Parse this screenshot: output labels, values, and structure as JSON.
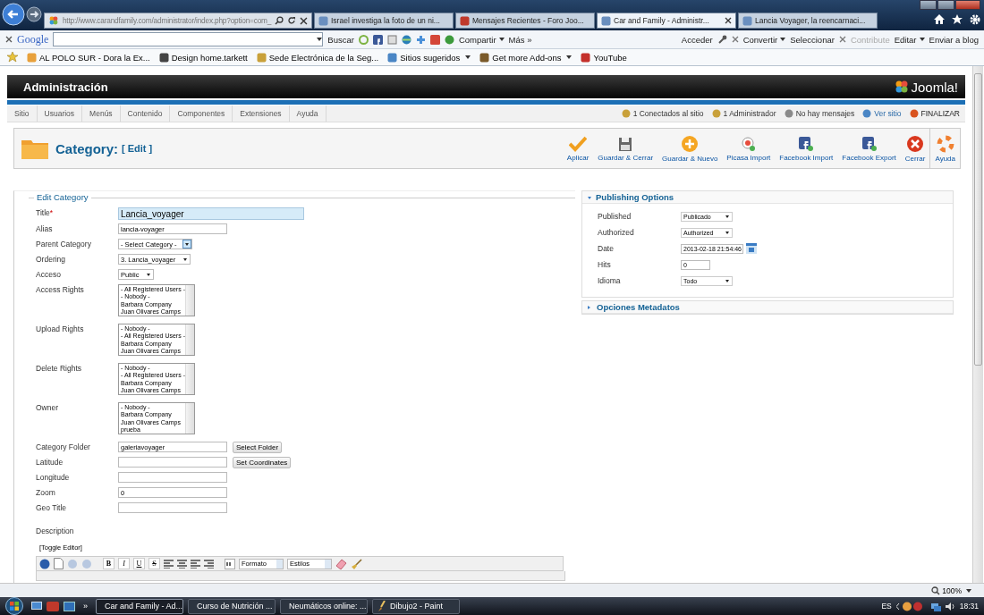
{
  "browser": {
    "address": "http://www.carandfamily.com/administrator/index.php?option=com_",
    "tabs": [
      {
        "title": "Israel investiga la foto de un ni...",
        "selected": false
      },
      {
        "title": "Mensajes Recientes - Foro Joo...",
        "selected": false
      },
      {
        "title": "Car and Family - Administr...",
        "selected": true
      },
      {
        "title": "Lancia Voyager, la reencarnaci...",
        "selected": false
      }
    ]
  },
  "google_toolbar": {
    "logo": "Google",
    "search_button": "Buscar",
    "share": "Compartir",
    "more": "Más »",
    "sign_in": "Acceder",
    "convert": "Convertir",
    "select": "Seleccionar",
    "contribute": {
      "label": "Contribute",
      "disabled": true
    },
    "edit": "Editar",
    "blog": "Enviar a blog"
  },
  "favorites": [
    {
      "label": "AL POLO SUR - Dora la Ex...",
      "kind": "link"
    },
    {
      "label": "Design  home.tarkett",
      "kind": "link"
    },
    {
      "label": "Sede Electrónica de la Seg...",
      "kind": "link"
    },
    {
      "label": "Sitios sugeridos",
      "kind": "menu"
    },
    {
      "label": "Get more Add-ons",
      "kind": "menu"
    },
    {
      "label": "YouTube",
      "kind": "link"
    }
  ],
  "admin": {
    "title": "Administración",
    "logo": "Joomla!",
    "menu": [
      "Sitio",
      "Usuarios",
      "Menús",
      "Contenido",
      "Componentes",
      "Extensiones",
      "Ayuda"
    ],
    "status": [
      {
        "label": "1 Conectados al sitio",
        "kind": "users"
      },
      {
        "label": "1 Administrador",
        "kind": "admin"
      },
      {
        "label": "No hay mensajes",
        "kind": "messages"
      },
      {
        "label": "Ver sitio",
        "kind": "site"
      },
      {
        "label": "FINALIZAR",
        "kind": "logout"
      }
    ]
  },
  "toolbar": {
    "title": "Category:",
    "subtitle": "[ Edit ]",
    "buttons": [
      {
        "label": "Aplicar",
        "kind": "apply"
      },
      {
        "label": "Guardar & Cerrar",
        "kind": "save"
      },
      {
        "label": "Guardar & Nuevo",
        "kind": "new"
      },
      {
        "label": "Picasa Import",
        "kind": "picasa"
      },
      {
        "label": "Facebook Import",
        "kind": "facebook"
      },
      {
        "label": "Facebook Export",
        "kind": "facebook"
      },
      {
        "label": "Cerrar",
        "kind": "close"
      },
      {
        "label": "Ayuda",
        "kind": "help"
      }
    ]
  },
  "edit_category": {
    "legend": "Edit Category",
    "fields": [
      {
        "kind": "title",
        "label": "Title",
        "required_mark": "*",
        "value": "Lancia_voyager"
      },
      {
        "kind": "text",
        "label": "Alias",
        "value": "lancia-voyager"
      },
      {
        "kind": "select",
        "label": "Parent Category",
        "value": "- Select Category -",
        "focused": true
      },
      {
        "kind": "select",
        "label": "Ordering",
        "value": "3. Lancia_voyager",
        "focused": false
      },
      {
        "kind": "select",
        "label": "Acceso",
        "value": "Public",
        "focused": false
      },
      {
        "kind": "listbox",
        "label": "Access Rights",
        "options": [
          "- All Registered Users -",
          "- Nobody -",
          "Barbara Company",
          "Juan Olivares Camps"
        ]
      },
      {
        "kind": "listbox",
        "label": "Upload Rights",
        "options": [
          "- Nobody -",
          "- All Registered Users -",
          "Barbara Company",
          "Juan Olivares Camps"
        ]
      },
      {
        "kind": "listbox",
        "label": "Delete Rights",
        "options": [
          "- Nobody -",
          "- All Registered Users -",
          "Barbara Company",
          "Juan Olivares Camps"
        ]
      },
      {
        "kind": "listbox",
        "label": "Owner",
        "options": [
          "- Nobody -",
          "Barbara Company",
          "Juan Olivares Camps",
          "prueba"
        ]
      },
      {
        "kind": "text_button",
        "label": "Category Folder",
        "value": "galeriavoyager",
        "button": "Select Folder"
      },
      {
        "kind": "text_button",
        "label": "Latitude",
        "button": "Set Coordinates"
      },
      {
        "kind": "text",
        "label": "Longitude"
      },
      {
        "kind": "text",
        "label": "Zoom",
        "value": "0"
      },
      {
        "kind": "text",
        "label": "Geo Title"
      }
    ],
    "description": {
      "label": "Description",
      "toggle": "[Toggle Editor]",
      "format_buttons": [
        {
          "text": "B",
          "kind": "bold"
        },
        {
          "text": "I",
          "kind": "italic"
        },
        {
          "text": "U",
          "kind": "underline"
        },
        {
          "text": "S",
          "kind": "strike"
        }
      ],
      "format": "Formato",
      "styles": "Estilos"
    }
  },
  "publishing": {
    "title": "Publishing Options",
    "expanded": true,
    "fields": [
      {
        "kind": "select",
        "label": "Published",
        "value": "Publicado"
      },
      {
        "kind": "select",
        "label": "Authorized",
        "value": "Authorized"
      },
      {
        "kind": "date",
        "label": "Date",
        "value": "2013-02-18 21:54:46"
      },
      {
        "kind": "text",
        "label": "Hits",
        "value": "0"
      },
      {
        "kind": "select",
        "label": "Idioma",
        "value": "Todo"
      }
    ]
  },
  "metadata": {
    "title": "Opciones Metadatos",
    "expanded": false
  },
  "status_bar": {
    "zoom": "100%"
  },
  "taskbar": {
    "items": [
      {
        "label": "Car and Family - Ad...",
        "kind": "browser",
        "selected": true
      },
      {
        "label": "Curso de Nutrición ...",
        "kind": "browser",
        "selected": false
      },
      {
        "label": "Neumáticos online: ...",
        "kind": "browser",
        "selected": false
      },
      {
        "label": "Dibujo2 - Paint",
        "kind": "paint",
        "selected": false
      }
    ],
    "more": "»",
    "language": "ES",
    "clock": "18:31"
  }
}
